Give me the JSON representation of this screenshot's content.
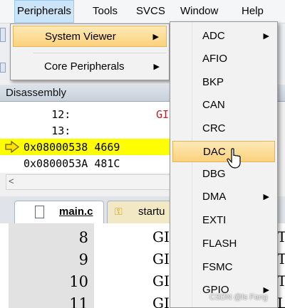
{
  "menubar": {
    "items": [
      {
        "label": "Peripherals"
      },
      {
        "label": "Tools"
      },
      {
        "label": "SVCS"
      },
      {
        "label": "Window"
      },
      {
        "label": "Help"
      }
    ]
  },
  "peripherals_menu": {
    "items": [
      {
        "label": "System Viewer",
        "has_submenu": true,
        "selected": true
      },
      {
        "label": "Core Peripherals",
        "has_submenu": true,
        "selected": false
      }
    ]
  },
  "system_viewer_submenu": {
    "items": [
      {
        "label": "ADC",
        "has_submenu": true
      },
      {
        "label": "AFIO"
      },
      {
        "label": "BKP"
      },
      {
        "label": "CAN"
      },
      {
        "label": "CRC"
      },
      {
        "label": "DAC",
        "selected": true
      },
      {
        "label": "DBG"
      },
      {
        "label": "DMA",
        "has_submenu": true
      },
      {
        "label": "EXTI"
      },
      {
        "label": "FLASH"
      },
      {
        "label": "FSMC"
      },
      {
        "label": "GPIO",
        "has_submenu": true
      }
    ]
  },
  "disassembly": {
    "title": "Disassembly",
    "lines": [
      {
        "text": "        12:"
      },
      {
        "text": "        13:"
      },
      {
        "text": "0x08000538 4669"
      },
      {
        "text": "0x0800053A 481C"
      }
    ],
    "partial_right": "GI"
  },
  "editor": {
    "tabs": [
      {
        "label": "main.c"
      },
      {
        "label": "startu"
      }
    ],
    "line_numbers": [
      "8",
      "9",
      "10",
      "11"
    ],
    "partial_text": [
      "GI",
      "GI",
      "GI",
      "GI"
    ],
    "right_partial": [
      "T",
      "T",
      "T",
      "L"
    ]
  },
  "watermark": "CSDN @ls Fang",
  "colors": {
    "menu_highlight_top": "#fde9b6",
    "menu_highlight_bottom": "#fbd27d",
    "execution_line": "#ffff00",
    "menubar_active": "#cce4f7"
  }
}
